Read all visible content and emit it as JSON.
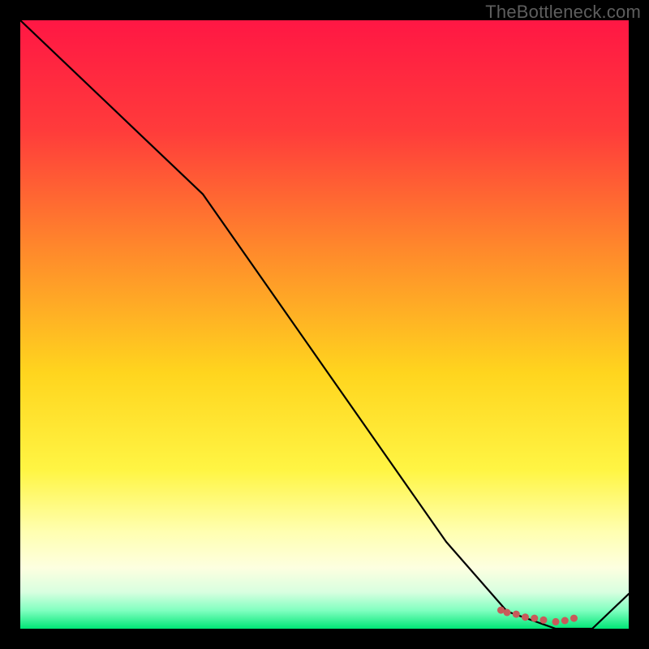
{
  "watermark": "TheBottleneck.com",
  "chart_data": {
    "type": "line",
    "title": "",
    "xlabel": "",
    "ylabel": "",
    "xlim": [
      0,
      100
    ],
    "ylim": [
      0,
      105
    ],
    "grid": false,
    "series": [
      {
        "name": "bottleneck-curve",
        "color": "#000000",
        "x": [
          0,
          10,
          20,
          30,
          40,
          50,
          60,
          70,
          80,
          88,
          94,
          100
        ],
        "y": [
          105,
          95,
          85,
          75,
          60,
          45,
          30,
          15,
          3,
          0,
          0,
          6
        ]
      }
    ],
    "markers": {
      "name": "highlight-dots",
      "color": "#c85a5a",
      "x": [
        79,
        80,
        81.5,
        83,
        84.5,
        86,
        88,
        89.5,
        91
      ],
      "y": [
        3.2,
        2.8,
        2.5,
        2.0,
        1.8,
        1.5,
        1.2,
        1.4,
        1.8
      ]
    },
    "gradient_stops": [
      {
        "offset": 0.0,
        "color": "#ff1744"
      },
      {
        "offset": 0.18,
        "color": "#ff3b3b"
      },
      {
        "offset": 0.38,
        "color": "#ff8a2b"
      },
      {
        "offset": 0.58,
        "color": "#ffd51e"
      },
      {
        "offset": 0.74,
        "color": "#fff544"
      },
      {
        "offset": 0.84,
        "color": "#ffffb0"
      },
      {
        "offset": 0.9,
        "color": "#fdffe0"
      },
      {
        "offset": 0.94,
        "color": "#d8ffe0"
      },
      {
        "offset": 0.97,
        "color": "#80ffc0"
      },
      {
        "offset": 1.0,
        "color": "#00e676"
      }
    ]
  }
}
